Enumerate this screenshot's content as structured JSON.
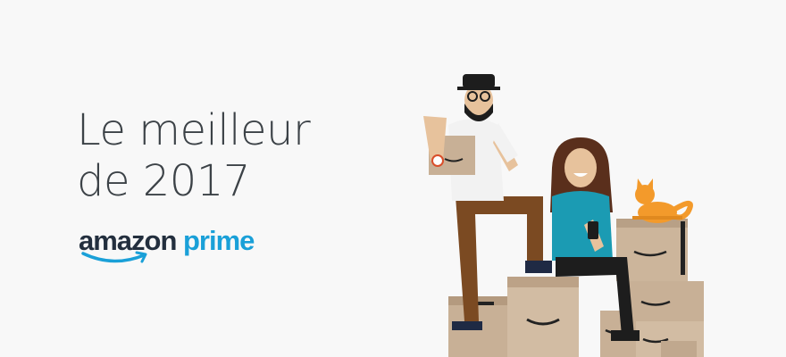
{
  "banner": {
    "headline_line1": "Le meilleur",
    "headline_line2": "de 2017",
    "logo_word_amazon": "amazon",
    "logo_word_prime": "prime"
  },
  "colors": {
    "background": "#f8f8f8",
    "headline": "#3c4247",
    "amazon_dark": "#232f3e",
    "prime_blue": "#1aa0d8",
    "smile_orange": "#f3a847",
    "box_tan": "#c8b096",
    "cat_orange": "#f39a2b"
  },
  "illustration": {
    "icons": [
      "man-figure",
      "woman-figure",
      "cat-icon",
      "smartphone-icon",
      "delivery-boxes"
    ]
  }
}
